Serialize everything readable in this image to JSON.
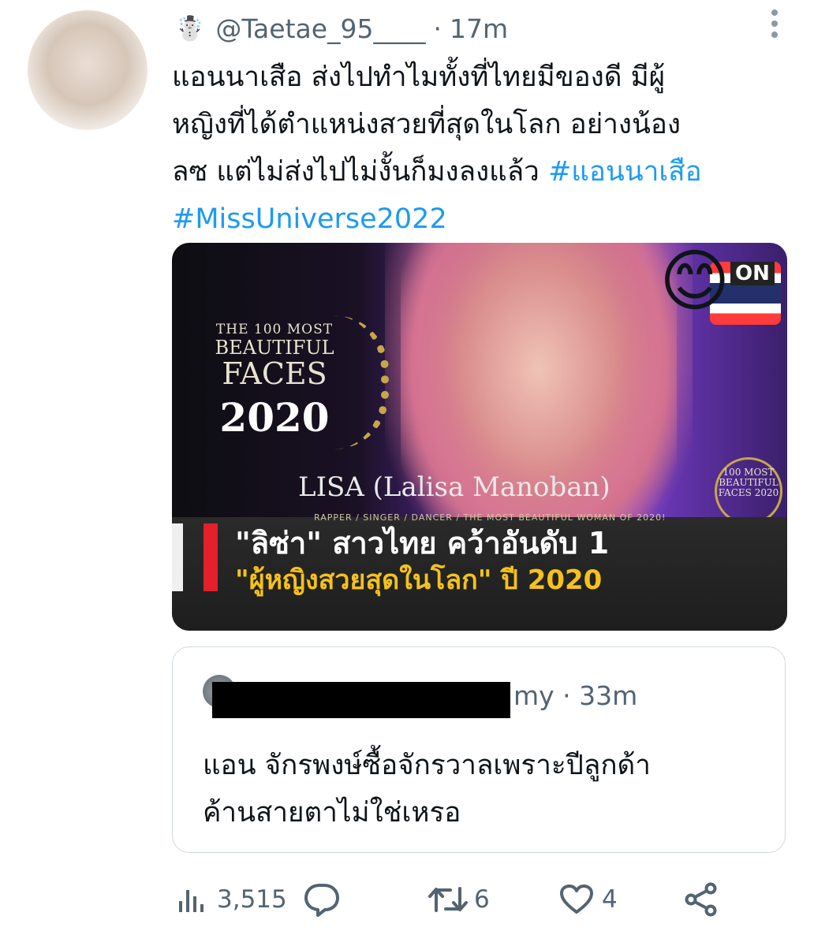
{
  "tweet": {
    "author_emoji": "☃️",
    "handle": "@Taetae_95____",
    "separator": "·",
    "time": "17m",
    "text_lines": [
      "แอนนาเสือ ส่งไปทำไมทั้งที่ไทยมีของดี มีผู้",
      "หญิงที่ได้ตำแหน่งสวยที่สุดในโลก อย่างน้อง",
      "ลซ แต่ไม่ส่งไปไม่งั้นก็มงลงแล้ว "
    ],
    "hashtags": [
      "#แอนนาเสือ",
      "#MissUniverse2022"
    ]
  },
  "media": {
    "badge_line1": "THE 100 MOST",
    "badge_line2": "BEAUTIFUL",
    "badge_line3": "FACES",
    "badge_year": "2020",
    "channel_label": "ON",
    "emoji": "😊",
    "name_caption": "LISA (Lalisa Manoban)",
    "subtitle_strip": "RAPPER / SINGER / DANCER / THE MOST BEAUTIFUL WOMAN OF 2020!",
    "badge_right": "100 MOST BEAUTIFUL FACES 2020",
    "headline_line1": "\"ลิซ่า\" สาวไทย คว้าอันดับ 1",
    "headline_line2": "\"ผู้หญิงสวยสุดในโลก\" ปี 2020"
  },
  "quoted": {
    "meta_suffix": "my · 33m",
    "text_lines": [
      "แอน จักรพงษ์ซื้อจักรวาลเพราะปีลูกด้า",
      "ค้านสายตาไม่ใช่เหรอ"
    ]
  },
  "actions": {
    "views": "3,515",
    "retweets": "6",
    "likes": "4"
  },
  "colors": {
    "hashtag": "#1d9bf0",
    "secondary_text": "#536471",
    "headline_yellow": "#f4c21a",
    "red_accent": "#e3202b"
  }
}
